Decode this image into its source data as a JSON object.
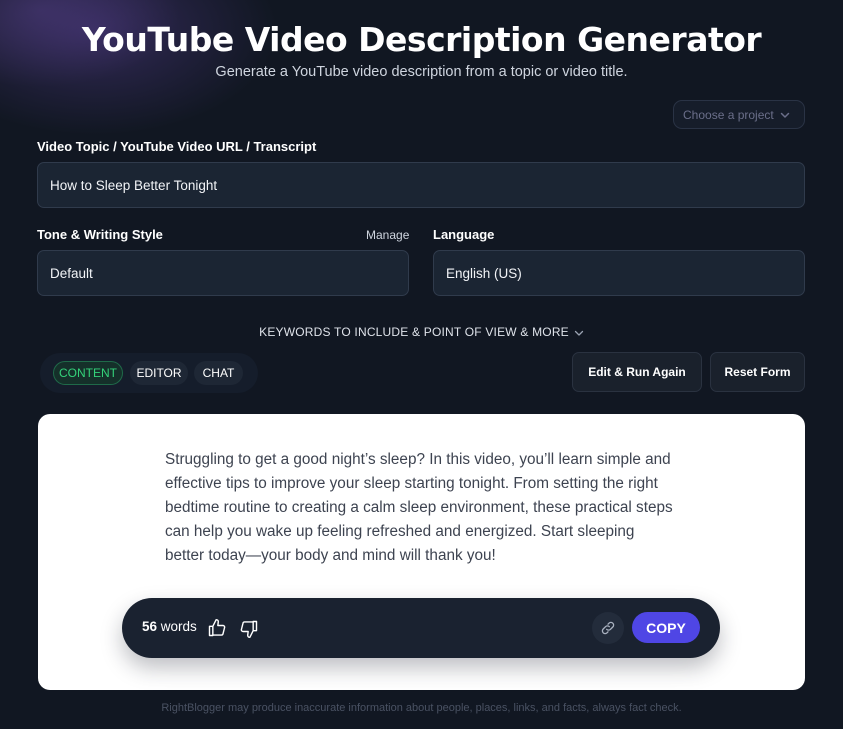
{
  "header": {
    "title": "YouTube Video Description Generator",
    "subtitle": "Generate a YouTube video description from a topic or video title."
  },
  "project_select": {
    "value": "Choose a project",
    "icon": "chevron-down-icon"
  },
  "topic": {
    "label": "Video Topic / YouTube Video URL / Transcript",
    "value": "How to Sleep Better Tonight"
  },
  "tone": {
    "label": "Tone & Writing Style",
    "manage_label": "Manage",
    "value": "Default"
  },
  "language": {
    "label": "Language",
    "value": "English (US)"
  },
  "more_options": {
    "label": "KEYWORDS TO INCLUDE & POINT OF VIEW & MORE"
  },
  "tabs": [
    {
      "label": "CONTENT",
      "active": true
    },
    {
      "label": "EDITOR",
      "active": false
    },
    {
      "label": "CHAT",
      "active": false
    }
  ],
  "actions": {
    "edit_run_label": "Edit & Run Again",
    "reset_label": "Reset Form"
  },
  "output": {
    "text": "Struggling to get a good night’s sleep? In this video, you’ll learn simple and effective tips to improve your sleep starting tonight. From setting the right bedtime routine to creating a calm sleep environment, these practical steps can help you wake up feeling refreshed and energized. Start sleeping better today—your body and mind will thank you!",
    "word_count": "56",
    "word_unit": "words",
    "copy_label": "COPY"
  },
  "footer": {
    "disclaimer": "RightBlogger may produce inaccurate information about people, places, links, and facts, always fact check."
  },
  "colors": {
    "background": "#111722",
    "accent": "#4f46e5",
    "active_tab": "#34d27a"
  }
}
